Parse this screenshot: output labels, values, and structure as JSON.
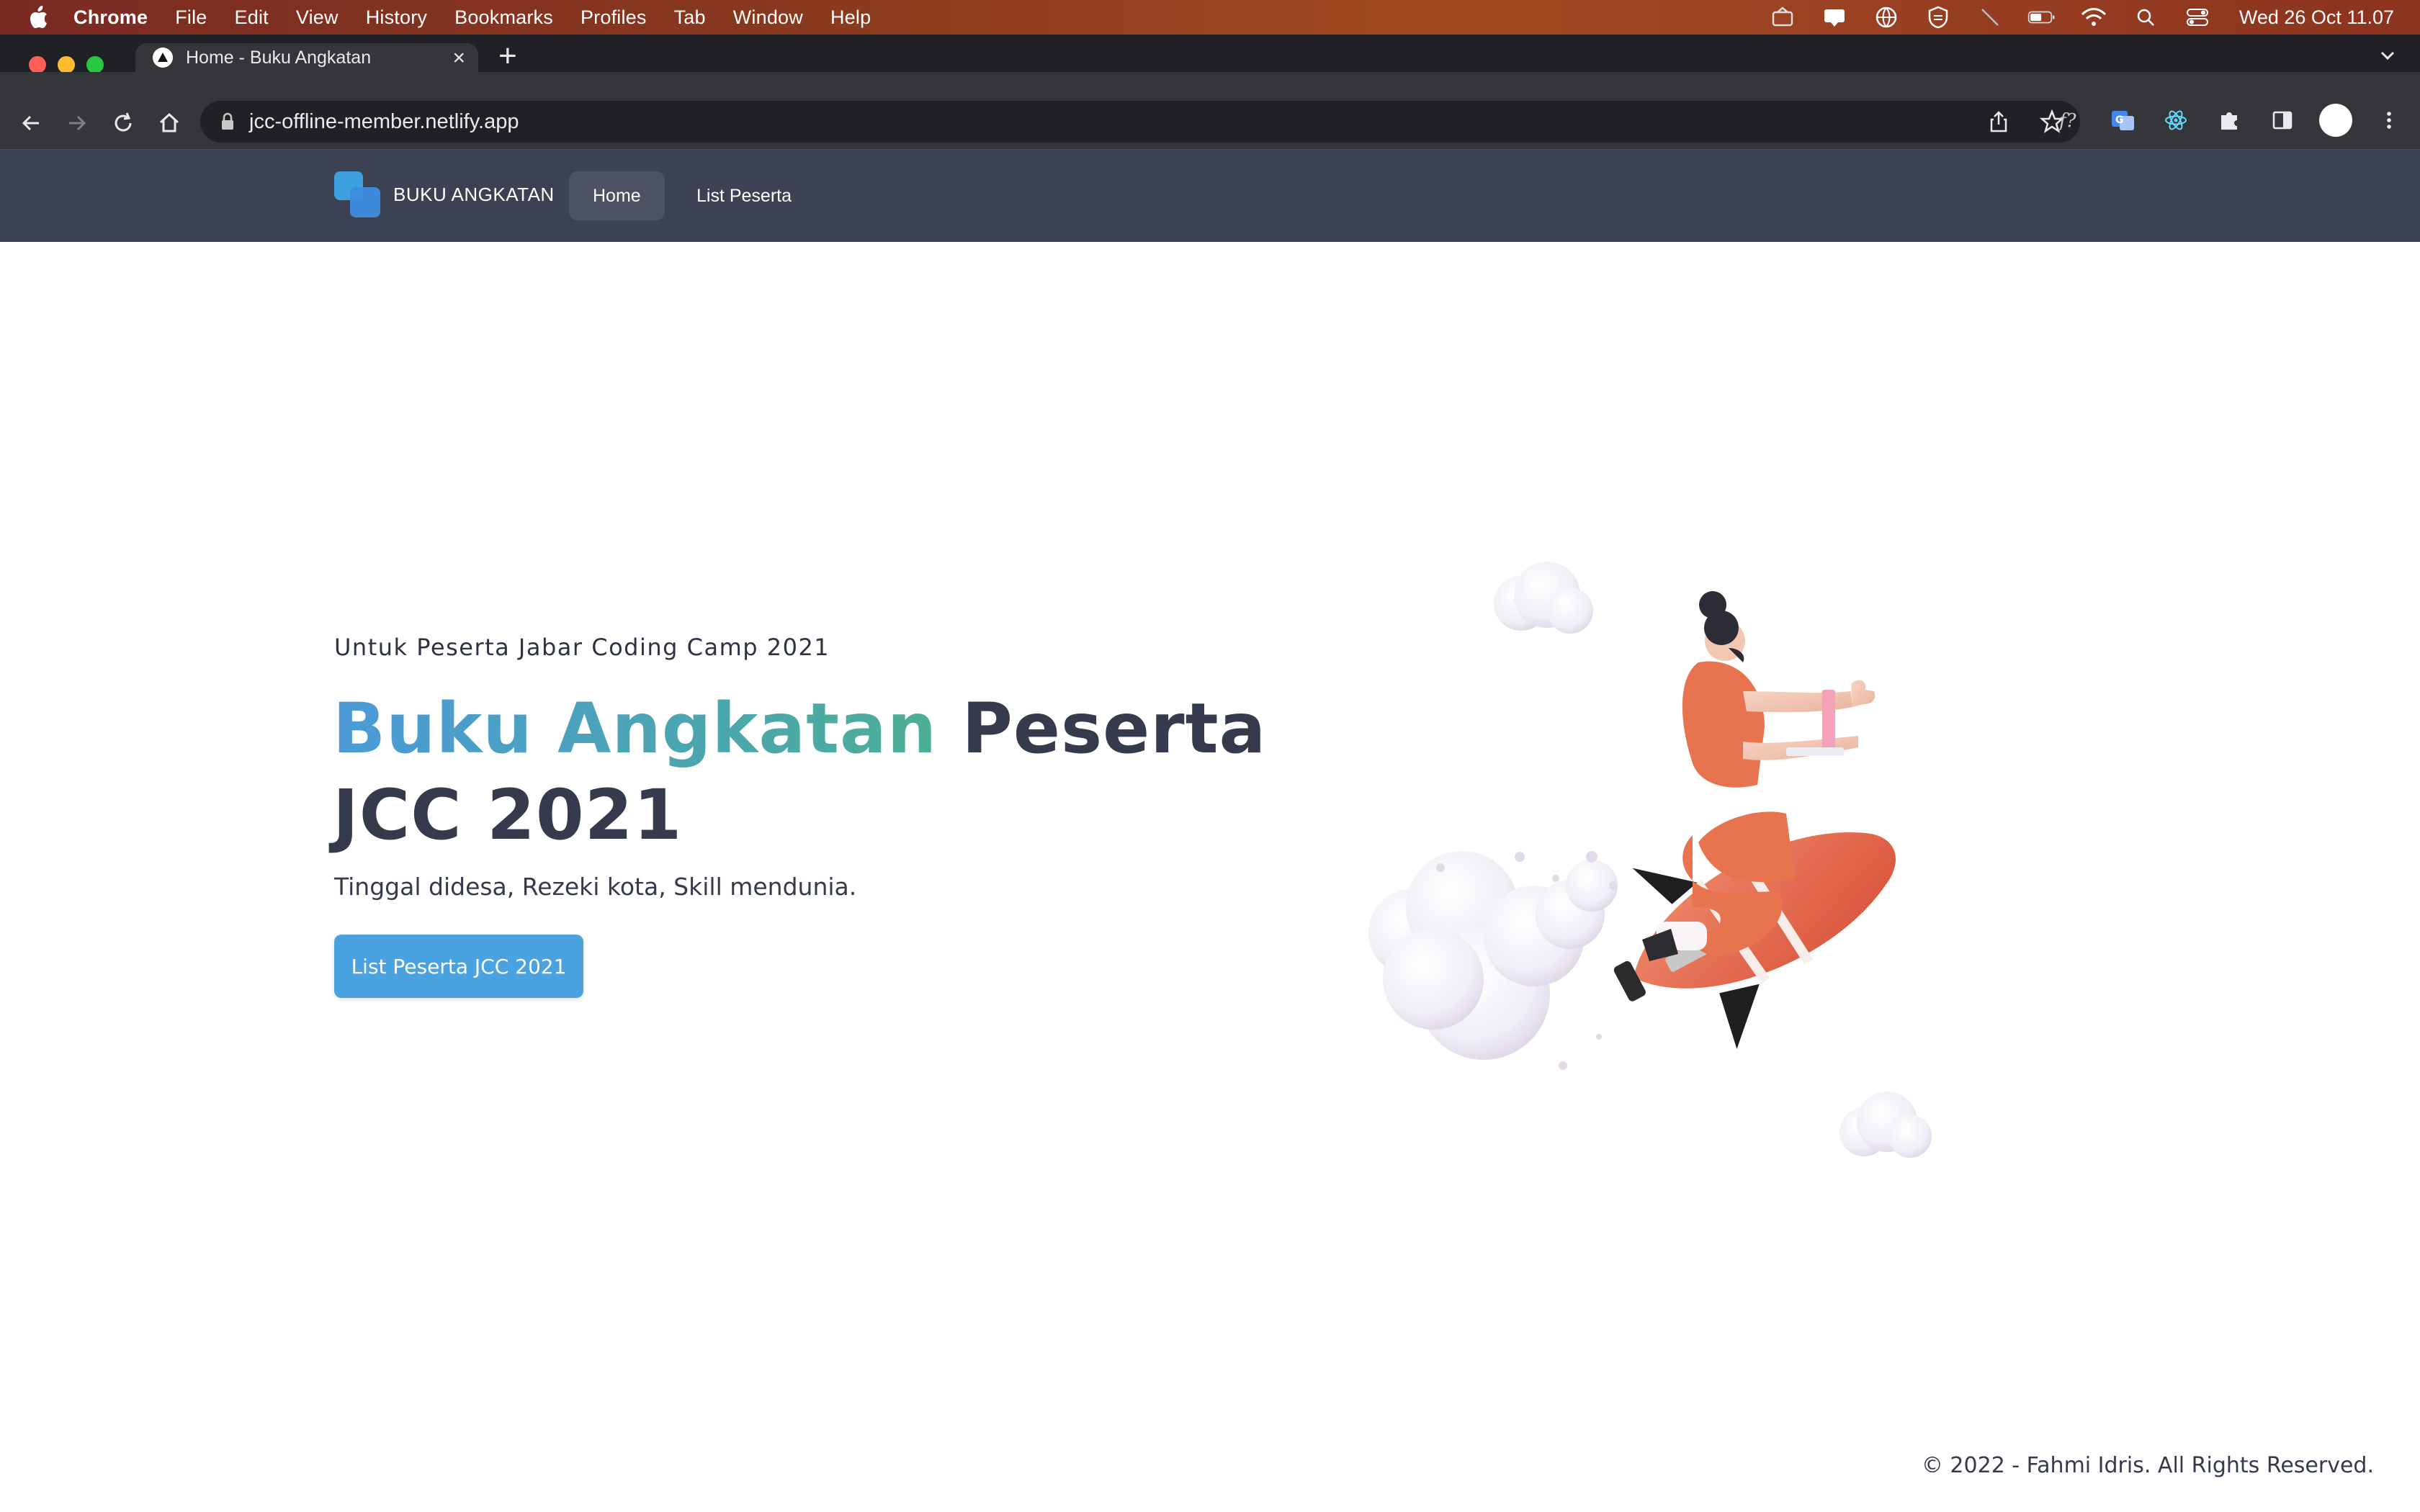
{
  "menubar": {
    "app": "Chrome",
    "items": [
      "File",
      "Edit",
      "View",
      "History",
      "Bookmarks",
      "Profiles",
      "Tab",
      "Window",
      "Help"
    ],
    "clock": "Wed 26 Oct  11.07",
    "status_icons": [
      "airdrop-icon",
      "notification-icon",
      "vpn-globe-icon",
      "shield-icon",
      "mute-icon",
      "battery-icon",
      "wifi-icon",
      "spotlight-search-icon",
      "control-center-icon"
    ]
  },
  "browser": {
    "tab_title": "Home - Buku Angkatan",
    "url": "jcc-offline-member.netlify.app",
    "extension_icons": [
      "function-icon",
      "translate-icon",
      "react-devtools-icon",
      "extensions-puzzle-icon",
      "side-panel-icon",
      "profile-avatar-icon",
      "more-menu-icon"
    ]
  },
  "site": {
    "brand": "BUKU ANGKATAN",
    "nav": [
      {
        "label": "Home",
        "active": true
      },
      {
        "label": "List Peserta",
        "active": false
      }
    ]
  },
  "hero": {
    "eyebrow": "Untuk Peserta Jabar Coding Camp 2021",
    "title_highlight": "Buku Angkatan",
    "title_rest_line1": " Peserta",
    "title_line2": "JCC 2021",
    "subtitle": "Tinggal didesa, Rezeki kota, Skill mendunia.",
    "cta_label": "List Peserta JCC 2021"
  },
  "footer": {
    "text": "© 2022 - Fahmi Idris. All Rights Reserved."
  },
  "colors": {
    "nav_bg": "#3c4253",
    "accent_blue": "#4aa3e0",
    "accent_green": "#4dae95",
    "heading": "#353a4c"
  }
}
